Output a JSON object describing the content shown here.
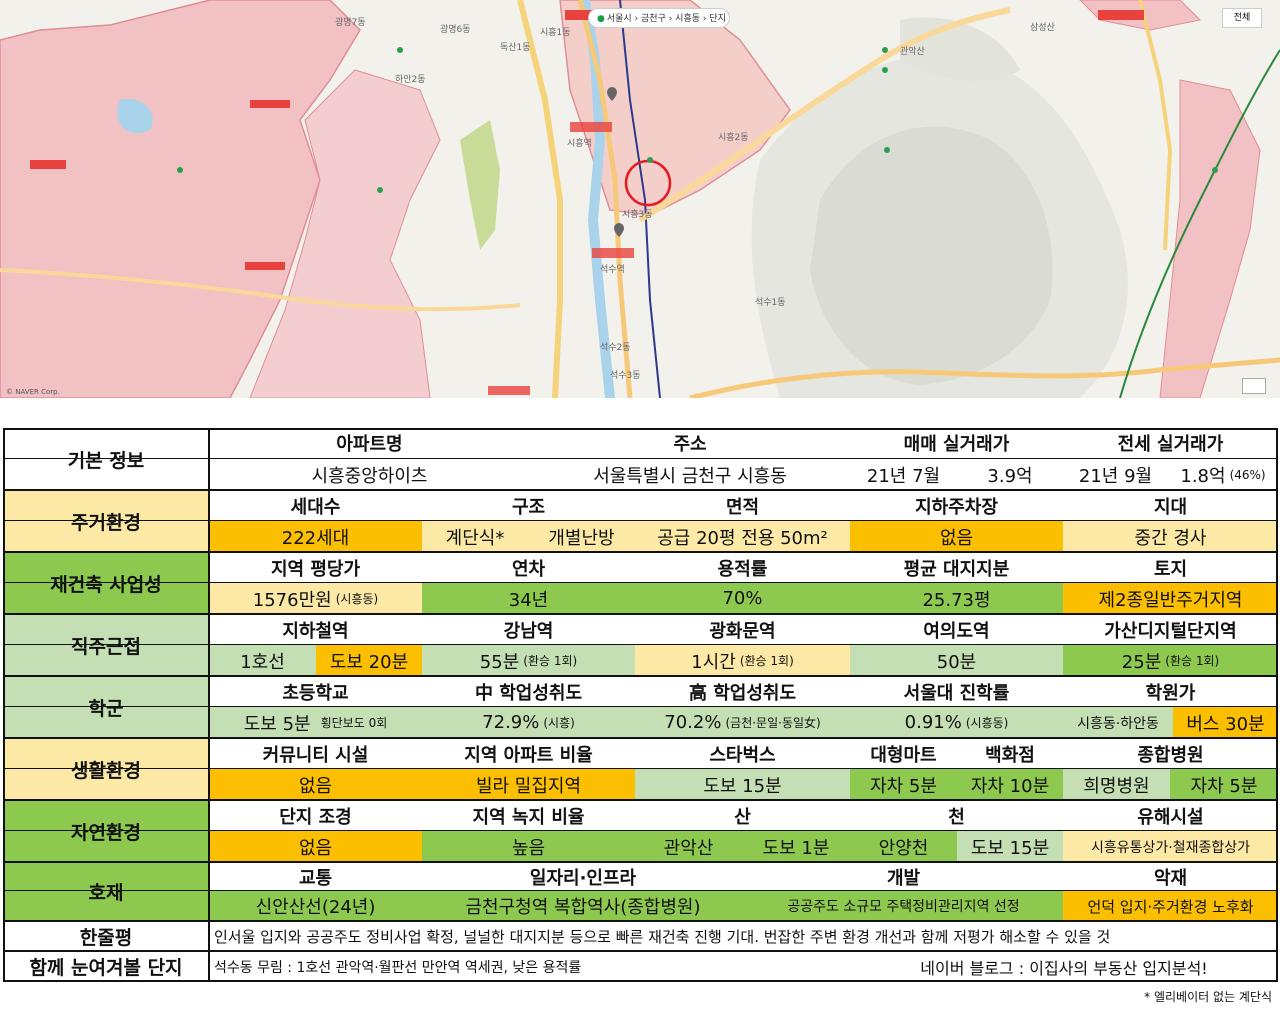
{
  "map": {
    "search_text": "서울시 › 금천구 › 시흥동 › 단지",
    "corner_label": "전체",
    "copyright": "© NAVER Corp.",
    "labels": [
      "시흥3동",
      "시흥2동",
      "시흥1동",
      "석수1동",
      "석수2동",
      "석수3동",
      "광명7동",
      "광명6동",
      "하안2동",
      "독산1동",
      "관악산",
      "삼성산",
      "석수역",
      "시흥역"
    ]
  },
  "table": {
    "basic": {
      "category": "기본 정보",
      "h_apt": "아파트명",
      "apt": "시흥중앙하이츠",
      "h_addr": "주소",
      "addr": "서울특별시 금천구 시흥동",
      "h_sale": "매매 실거래가",
      "sale_date": "21년 7월",
      "sale_price": "3.9억",
      "h_jeonse": "전세 실거래가",
      "jeonse_date": "21년 9월",
      "jeonse_price": "1.8억",
      "jeonse_ratio": "(46%)"
    },
    "living": {
      "category": "주거환경",
      "h_households": "세대수",
      "households": "222세대",
      "h_structure": "구조",
      "structure_type": "계단식*",
      "heating": "개별난방",
      "h_area": "면적",
      "area": "공급 20평  전용 50m²",
      "h_parking": "지하주차장",
      "parking": "없음",
      "h_terrain": "지대",
      "terrain": "중간 경사"
    },
    "rebuild": {
      "category": "재건축 사업성",
      "h_price": "지역 평당가",
      "price": "1576만원",
      "price_note": "(시흥동)",
      "h_age": "연차",
      "age": "34년",
      "h_far": "용적률",
      "far": "70%",
      "h_land": "평균 대지지분",
      "land": "25.73평",
      "h_zone": "토지",
      "zone": "제2종일반주거지역"
    },
    "commute": {
      "category": "직주근접",
      "h_subway": "지하철역",
      "subway": "1호선",
      "subway_walk": "도보 20분",
      "h_gangnam": "강남역",
      "gangnam": "55분",
      "gangnam_note": "(환승 1회)",
      "h_gwanghwamun": "광화문역",
      "gwanghwamun": "1시간",
      "gwanghwamun_note": "(환승 1회)",
      "h_yeouido": "여의도역",
      "yeouido": "50분",
      "h_gasan": "가산디지털단지역",
      "gasan": "25분",
      "gasan_note": "(환승 1회)"
    },
    "school": {
      "category": "학군",
      "h_elem": "초등학교",
      "elem": "도보 5분",
      "elem_note": "횡단보도 0회",
      "h_middle": "中 학업성취도",
      "middle": "72.9%",
      "middle_note": "(시흥)",
      "h_high": "高 학업성취도",
      "high": "70.2%",
      "high_note": "(금천·문일·동일女)",
      "h_snu": "서울대 진학률",
      "snu": "0.91%",
      "snu_note": "(시흥동)",
      "h_academy": "학원가",
      "academy_area": "시흥동·하안동",
      "academy_time": "버스 30분"
    },
    "life": {
      "category": "생활환경",
      "h_community": "커뮤니티 시설",
      "community": "없음",
      "h_ratio": "지역 아파트 비율",
      "ratio": "빌라 밀집지역",
      "h_starbucks": "스타벅스",
      "starbucks": "도보 15분",
      "h_mart": "대형마트",
      "mart": "자차 5분",
      "h_dept": "백화점",
      "dept": "자차 10분",
      "h_hospital": "종합병원",
      "hospital": "희명병원",
      "hospital_time": "자차 5분"
    },
    "nature": {
      "category": "자연환경",
      "h_landscape": "단지 조경",
      "landscape": "없음",
      "h_green": "지역 녹지 비율",
      "green": "높음",
      "h_mountain": "산",
      "mountain": "관악산",
      "mountain_time": "도보 1분",
      "h_stream": "천",
      "stream": "안양천",
      "stream_time": "도보 15분",
      "h_hazard": "유해시설",
      "hazard": "시흥유통상가·철재종합상가"
    },
    "benefit": {
      "category": "호재",
      "h_traffic": "교통",
      "traffic": "신안산선(24년)",
      "h_jobs": "일자리·인프라",
      "jobs": "금천구청역 복합역사(종합병원)",
      "h_dev": "개발",
      "dev": "공공주도 소규모 주택정비관리지역 선정",
      "h_bad": "악재",
      "bad": "언덕 입지·주거환경 노후화"
    },
    "summary": {
      "category": "한줄평",
      "text": "인서울 입지와 공공주도 정비사업 확정, 널널한 대지지분 등으로 빠른 재건축 진행 기대. 번잡한 주변 환경 개선과 함께 저평가 해소할 수 있을 것"
    },
    "together": {
      "category": "함께 눈여겨볼 단지",
      "text": "석수동 무림 : 1호선 관악역·월판선 만안역 역세권, 낮은 용적률",
      "blog": "네이버 블로그 : 이집사의 부동산 입지분석!"
    }
  },
  "footnote": "* 엘리베이터 없는 계단식",
  "colors": {
    "light_yellow": "#fde9a6",
    "orange": "#fcbf00",
    "light_green": "#c5dfb4",
    "green": "#8dc84f",
    "map_zone": "#f2c1c4"
  }
}
